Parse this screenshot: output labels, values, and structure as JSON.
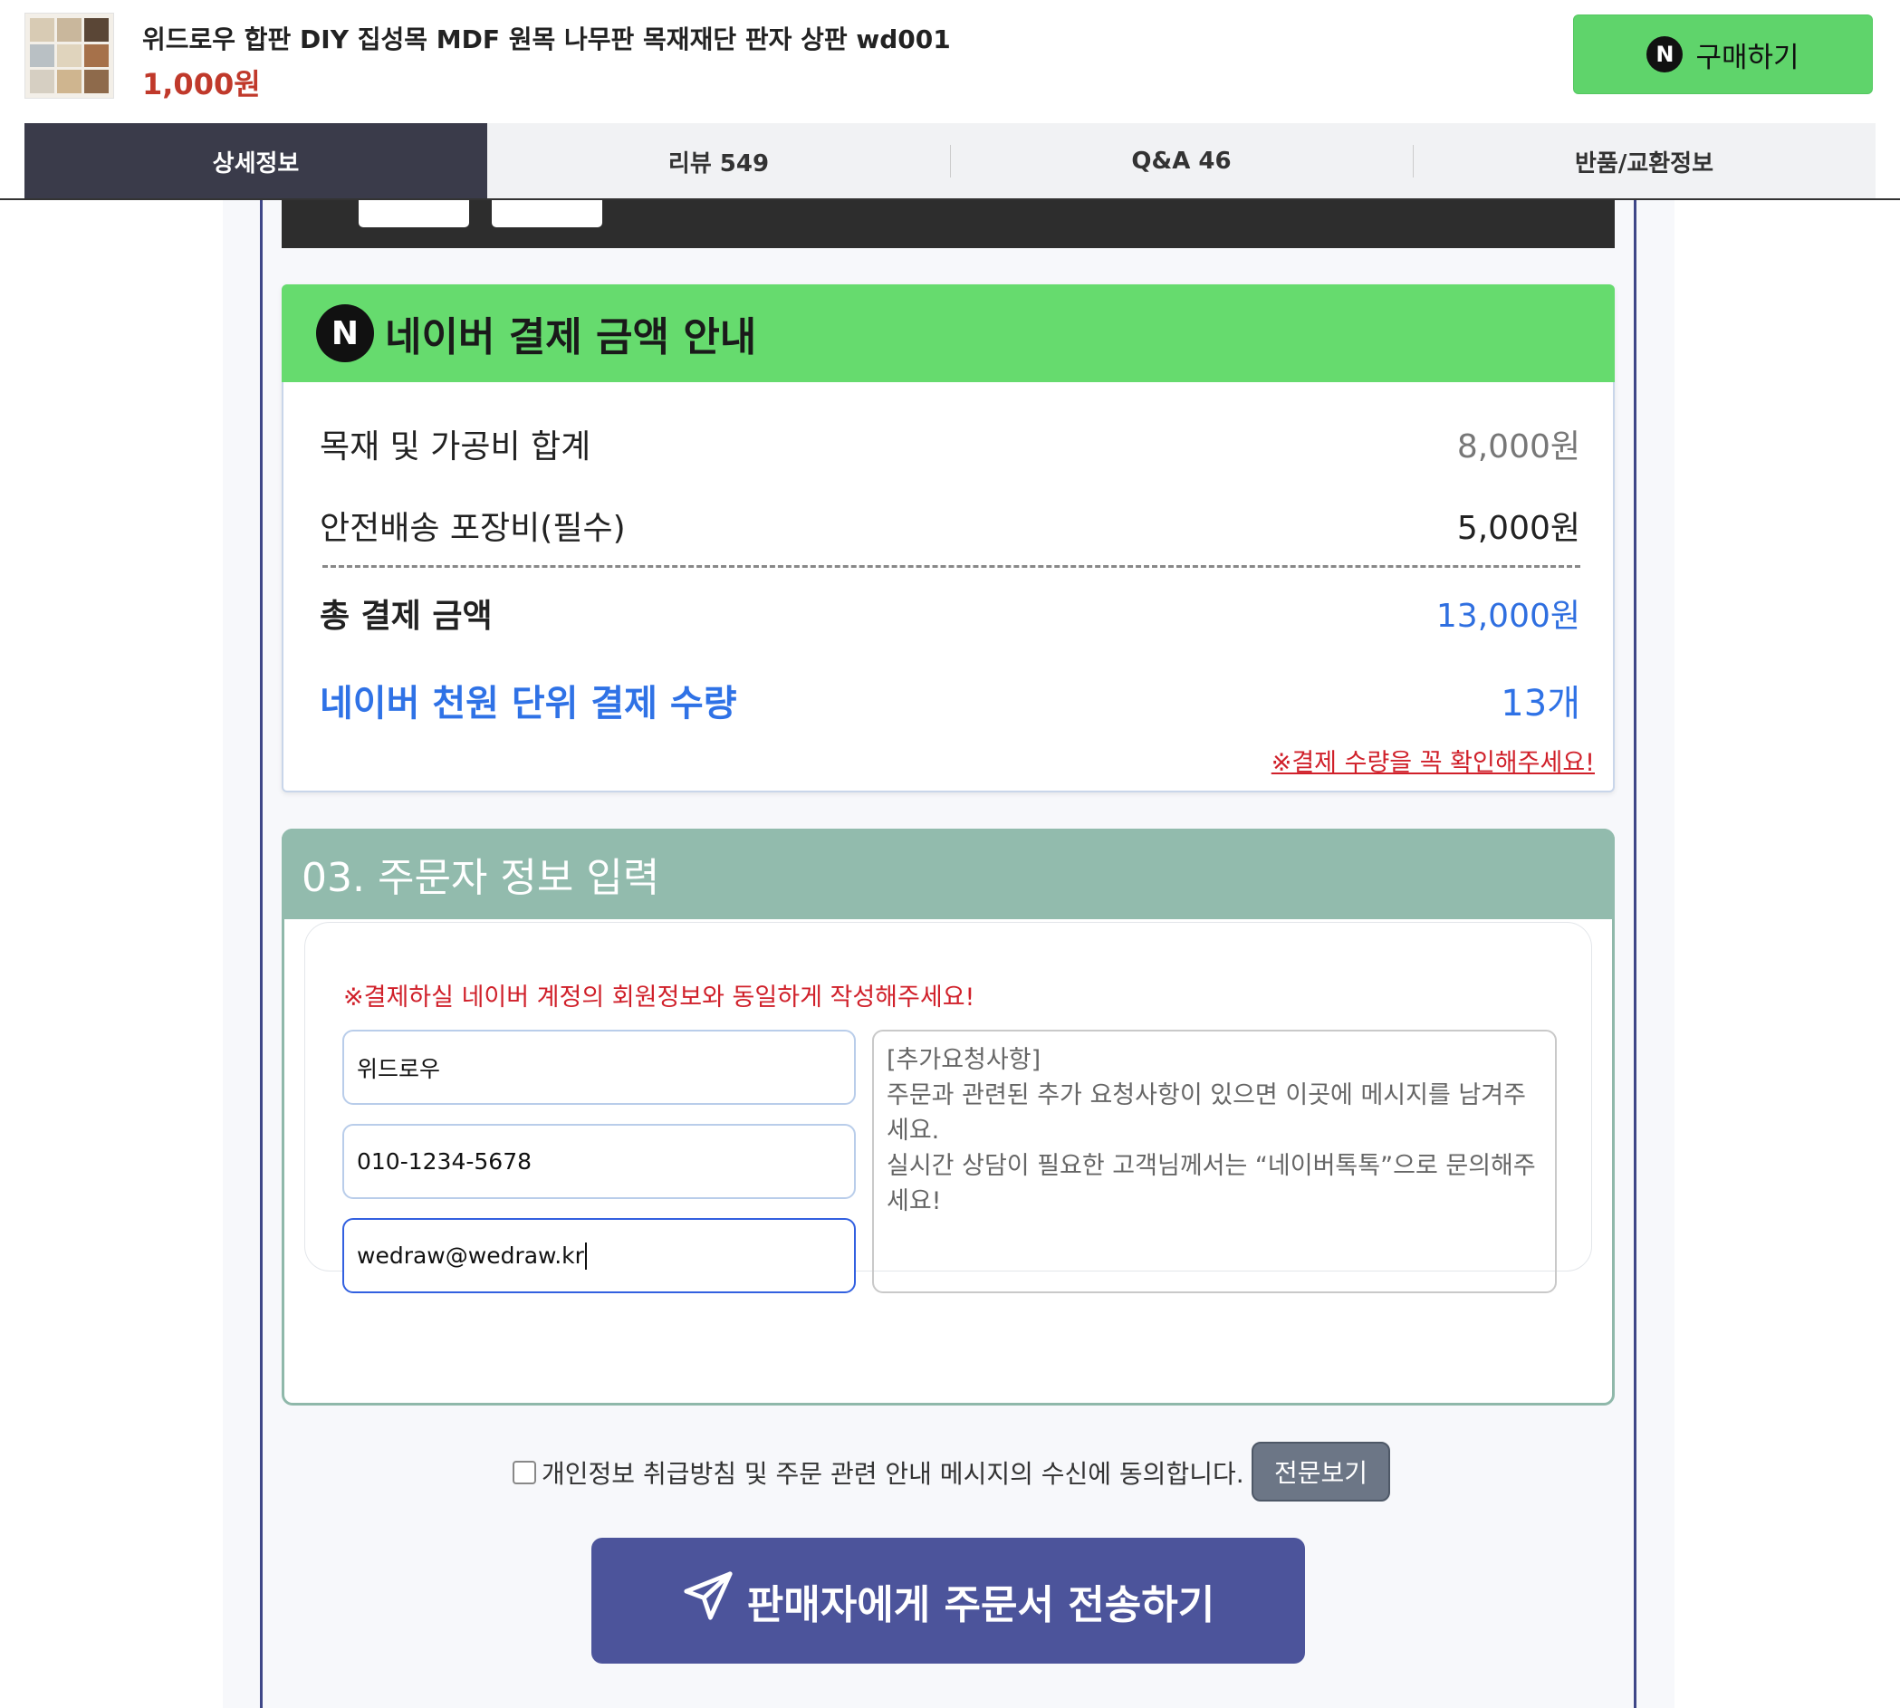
{
  "product": {
    "title": "위드로우 합판 DIY 집성목 MDF 원목 나무판 목재재단 판자 상판 wd001",
    "price": "1,000원",
    "buy_label": "구매하기",
    "naver_badge": "N"
  },
  "tabs": [
    {
      "label": "상세정보",
      "active": true
    },
    {
      "label": "리뷰 549",
      "active": false
    },
    {
      "label": "Q&A 46",
      "active": false
    },
    {
      "label": "반품/교환정보",
      "active": false
    }
  ],
  "naver_payment": {
    "title": "네이버 결제 금액 안내",
    "rows": [
      {
        "label": "목재 및 가공비 합계",
        "value": "8,000원"
      },
      {
        "label": "안전배송 포장비(필수)",
        "value": "5,000원"
      },
      {
        "label": "총 결제 금액",
        "value": "13,000원"
      },
      {
        "label": "네이버 천원 단위 결제 수량",
        "value": "13개"
      }
    ],
    "warning": "※결제 수량을 꼭 확인해주세요!"
  },
  "order_form": {
    "title": "03. 주문자 정보 입력",
    "notice": "※결제하실 네이버 계정의 회원정보와 동일하게 작성해주세요!",
    "name_value": "위드로우",
    "phone_value": "010-1234-5678",
    "email_value": "wedraw@wedraw.kr",
    "request_placeholder": "[추가요청사항]\n주문과 관련된 추가 요청사항이 있으면 이곳에 메시지를 남겨주세요.\n실시간 상담이 필요한 고객님께서는 “네이버톡톡”으로 문의해주세요!"
  },
  "agreement": {
    "label": "개인정보 취급방침 및 주문 관련 안내 메시지의 수신에 동의합니다.",
    "view_label": "전문보기",
    "checked": false
  },
  "submit": {
    "label": "판매자에게 주문서 전송하기",
    "icon": "paper-plane-icon"
  },
  "colors": {
    "naver_green": "#66db6e",
    "order_header": "#92bbad",
    "submit_bg": "#4c549b",
    "price_red": "#c0392b",
    "accent_blue": "#2f72e6"
  }
}
